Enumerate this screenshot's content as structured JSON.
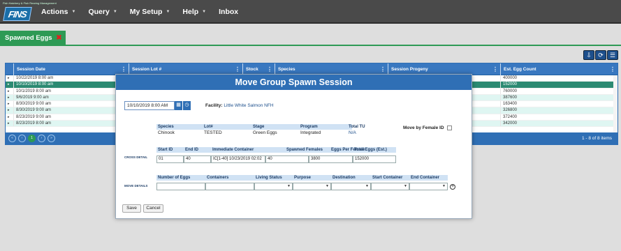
{
  "app": {
    "logo_caption": "Fish Hatchery & Fish Rearing Management",
    "logo_text": "FINS"
  },
  "menu": [
    {
      "label": "Actions"
    },
    {
      "label": "Query"
    },
    {
      "label": "My Setup"
    },
    {
      "label": "Help"
    },
    {
      "label": "Inbox"
    }
  ],
  "tab": {
    "label": "Spawned Eggs",
    "close": "✖"
  },
  "toolbar": {
    "export": "⇩",
    "refresh": "⟳",
    "columns": "☰"
  },
  "grid": {
    "columns": [
      "Session Date",
      "Session Lot #",
      "Stock",
      "Species",
      "Session Progeny",
      "Est. Egg Count"
    ],
    "rows": [
      {
        "date": "10/22/2019 8:00 am",
        "count": "400000"
      },
      {
        "date": "10/10/2019 8:00 am",
        "count": "152000"
      },
      {
        "date": "10/1/2019 8:00 am",
        "count": "760000"
      },
      {
        "date": "9/6/2019 9:00 am",
        "count": "387600"
      },
      {
        "date": "8/30/2019 9:00 am",
        "count": "163400"
      },
      {
        "date": "8/30/2019 9:00 am",
        "count": "326800"
      },
      {
        "date": "8/23/2019 9:00 am",
        "count": "372400"
      },
      {
        "date": "8/23/2019 8:00 am",
        "count": "342000"
      }
    ],
    "pager": {
      "first": "«",
      "prev": "‹",
      "current": "1",
      "next": "›",
      "last": "»",
      "info": "1 - 8 of 8 items"
    }
  },
  "modal": {
    "title": "Move Group Spawn Session",
    "date_value": "10/10/2019 8:00 AM",
    "facility_label": "Facility:",
    "facility_value": "Little White Salmon NFH",
    "species_table": {
      "headers": [
        "Species",
        "Lot#",
        "Stage",
        "Program",
        "Total TU"
      ],
      "values": [
        "Chinook",
        "TESTED",
        "Green Eggs",
        "Integrated",
        "N/A"
      ]
    },
    "move_by_female_label": "Move by Female ID",
    "cross_detail_label": "CROSS DETAIL",
    "cross_table": {
      "headers": [
        "Start ID",
        "End ID",
        "Immediate Container",
        "Spawned Females",
        "Eggs Per Female",
        "Total Eggs (Est.)"
      ],
      "values": [
        "01",
        "40",
        "IC[1-40] 10/23/2019 02:02",
        "40",
        "3800",
        "152000"
      ]
    },
    "move_details_label": "MOVE DETAILS",
    "move_table": {
      "headers": [
        "Number of Eggs",
        "Containers",
        "Living Status",
        "Purpose",
        "Destination",
        "Start Container",
        "End Container"
      ]
    },
    "add_icon": "+",
    "save_label": "Save",
    "cancel_label": "Cancel"
  },
  "colors": {
    "nav_bg": "#4a4a4a",
    "accent_blue": "#2f6fb5",
    "tab_green": "#2e9a55",
    "row_selected": "#2c8a72",
    "row_alt": "#dff6f2"
  }
}
